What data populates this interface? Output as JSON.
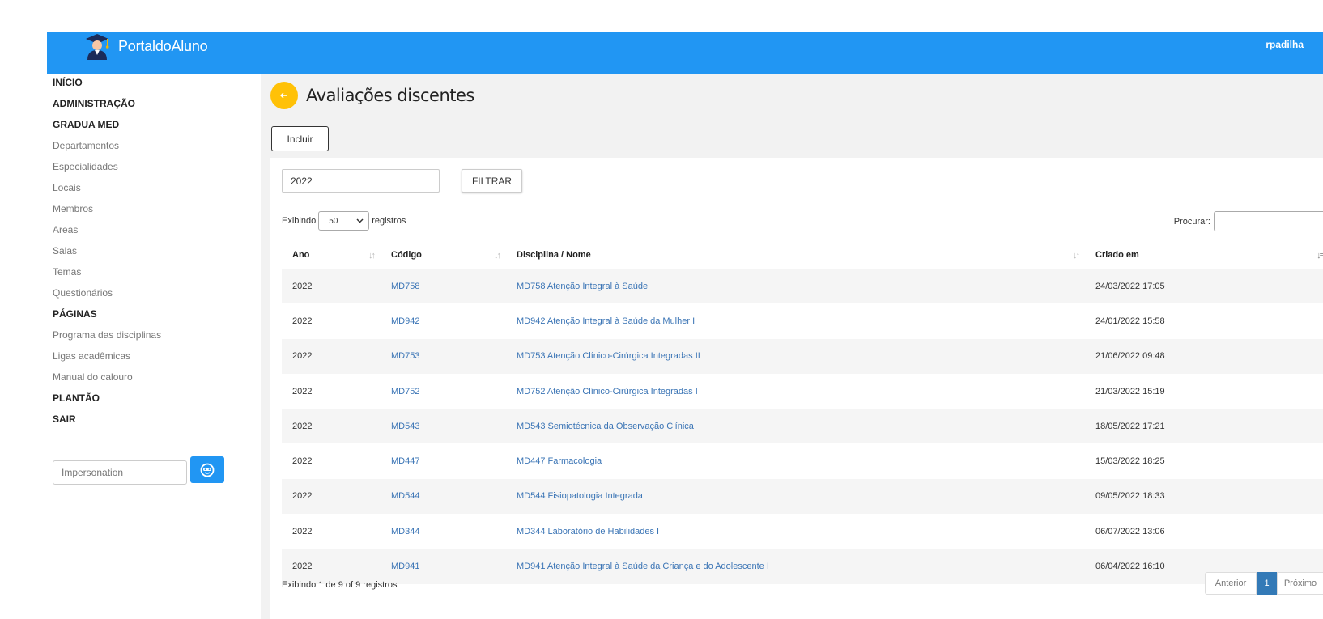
{
  "header": {
    "brand": "PortaldoAluno",
    "user": "rpadilha",
    "accent": "#2196f3"
  },
  "sidebar": {
    "items": [
      {
        "label": "INÍCIO",
        "kind": "head"
      },
      {
        "label": "ADMINISTRAÇÃO",
        "kind": "head"
      },
      {
        "label": "GRADUA MED",
        "kind": "head"
      },
      {
        "label": "Departamentos",
        "kind": "sub"
      },
      {
        "label": "Especialidades",
        "kind": "sub"
      },
      {
        "label": "Locais",
        "kind": "sub"
      },
      {
        "label": "Membros",
        "kind": "sub"
      },
      {
        "label": "Areas",
        "kind": "sub"
      },
      {
        "label": "Salas",
        "kind": "sub"
      },
      {
        "label": "Temas",
        "kind": "sub"
      },
      {
        "label": "Questionários",
        "kind": "sub"
      },
      {
        "label": "PÁGINAS",
        "kind": "head"
      },
      {
        "label": "Programa das disciplinas",
        "kind": "sub"
      },
      {
        "label": "Ligas acadêmicas",
        "kind": "sub"
      },
      {
        "label": "Manual do calouro",
        "kind": "sub"
      },
      {
        "label": "PLANTÃO",
        "kind": "head"
      },
      {
        "label": "SAIR",
        "kind": "head"
      }
    ],
    "impersonation_placeholder": "Impersonation"
  },
  "main": {
    "title": "Avaliações discentes",
    "include_label": "Incluir",
    "filter_value": "2022",
    "filter_label": "FILTRAR",
    "length_prefix": "Exibindo",
    "length_value": "50",
    "length_suffix": "registros",
    "search_label": "Procurar:",
    "columns": [
      "Ano",
      "Código",
      "Disciplina / Nome",
      "Criado em"
    ],
    "rows": [
      {
        "ano": "2022",
        "codigo": "MD758",
        "nome": "MD758 Atenção Integral à Saúde",
        "criado": "24/03/2022 17:05"
      },
      {
        "ano": "2022",
        "codigo": "MD942",
        "nome": "MD942 Atenção Integral à Saúde da Mulher I",
        "criado": "24/01/2022 15:58"
      },
      {
        "ano": "2022",
        "codigo": "MD753",
        "nome": "MD753 Atenção Clínico-Cirúrgica Integradas II",
        "criado": "21/06/2022 09:48"
      },
      {
        "ano": "2022",
        "codigo": "MD752",
        "nome": "MD752 Atenção Clínico-Cirúrgica Integradas I",
        "criado": "21/03/2022 15:19"
      },
      {
        "ano": "2022",
        "codigo": "MD543",
        "nome": "MD543 Semiotécnica da Observação Clínica",
        "criado": "18/05/2022 17:21"
      },
      {
        "ano": "2022",
        "codigo": "MD447",
        "nome": "MD447 Farmacologia",
        "criado": "15/03/2022 18:25"
      },
      {
        "ano": "2022",
        "codigo": "MD544",
        "nome": "MD544 Fisiopatologia Integrada",
        "criado": "09/05/2022 18:33"
      },
      {
        "ano": "2022",
        "codigo": "MD344",
        "nome": "MD344 Laboratório de Habilidades I",
        "criado": "06/07/2022 13:06"
      },
      {
        "ano": "2022",
        "codigo": "MD941",
        "nome": "MD941 Atenção Integral à Saúde da Criança e do Adolescente I",
        "criado": "06/04/2022 16:10"
      }
    ],
    "info": "Exibindo 1 de 9 of 9 registros",
    "pager": {
      "prev": "Anterior",
      "current": "1",
      "next": "Próximo"
    }
  }
}
